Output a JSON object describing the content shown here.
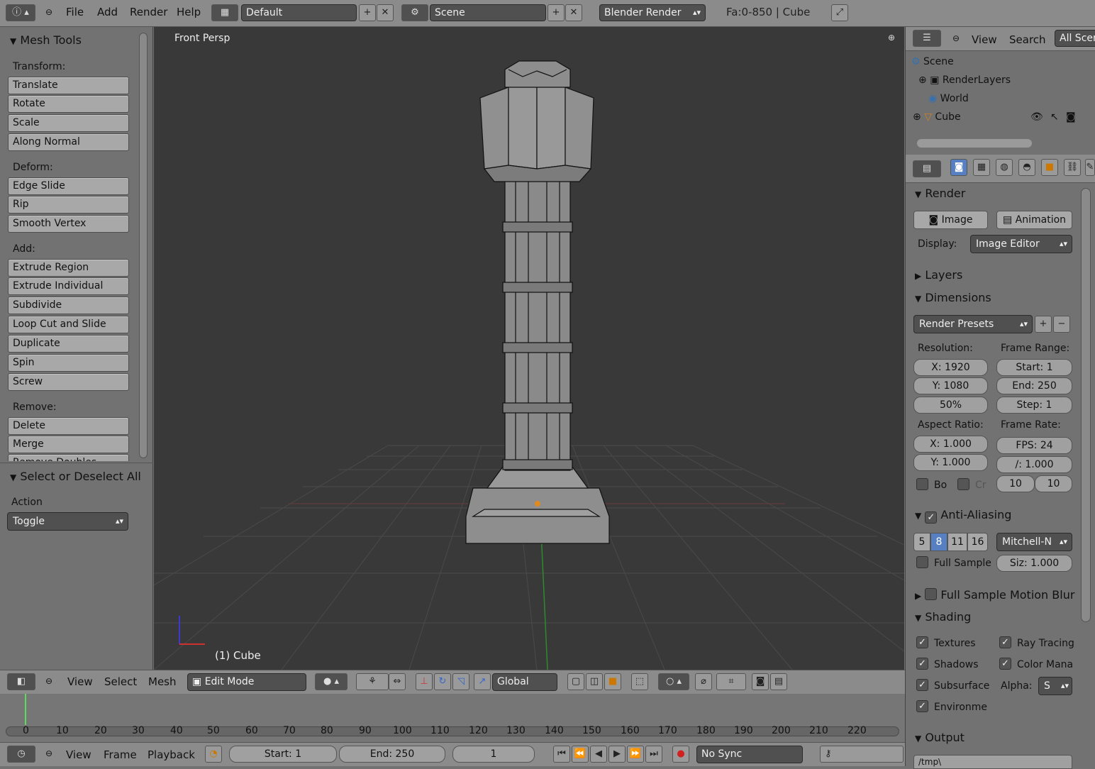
{
  "topbar": {
    "menus": [
      "File",
      "Add",
      "Render",
      "Help"
    ],
    "screen_layout": "Default",
    "scene": "Scene",
    "engine": "Blender Render",
    "stats": "Fa:0-850 | Cube"
  },
  "toolshelf": {
    "title": "Mesh Tools",
    "transform_label": "Transform:",
    "transform": [
      "Translate",
      "Rotate",
      "Scale",
      "Along Normal"
    ],
    "deform_label": "Deform:",
    "deform": [
      "Edge Slide",
      "Rip",
      "Smooth Vertex"
    ],
    "add_label": "Add:",
    "add": [
      "Extrude Region",
      "Extrude Individual",
      "Subdivide",
      "Loop Cut and Slide",
      "Duplicate",
      "Spin",
      "Screw"
    ],
    "remove_label": "Remove:",
    "remove": [
      "Delete",
      "Merge",
      "Remove Doubles"
    ],
    "operator_title": "Select or Deselect All",
    "action_label": "Action",
    "action_value": "Toggle"
  },
  "viewport": {
    "view_name": "Front Persp",
    "object_label": "(1) Cube"
  },
  "view_header": {
    "menus": [
      "View",
      "Select",
      "Mesh"
    ],
    "mode": "Edit Mode",
    "orientation": "Global"
  },
  "timeline": {
    "ticks": [
      "0",
      "10",
      "20",
      "30",
      "40",
      "50",
      "60",
      "70",
      "80",
      "90",
      "100",
      "110",
      "120",
      "130",
      "140",
      "150",
      "160",
      "170",
      "180",
      "190",
      "200",
      "210",
      "220"
    ],
    "menus": [
      "View",
      "Frame",
      "Playback"
    ],
    "start": "Start: 1",
    "end": "End: 250",
    "current": "1",
    "sync": "No Sync"
  },
  "outliner": {
    "menus": [
      "View",
      "Search"
    ],
    "filter": "All Scenes",
    "items": [
      "Scene",
      "RenderLayers",
      "World",
      "Cube"
    ]
  },
  "properties": {
    "render_title": "Render",
    "image_btn": "Image",
    "animation_btn": "Animation",
    "display_label": "Display:",
    "display_value": "Image Editor",
    "layers_title": "Layers",
    "dimensions_title": "Dimensions",
    "presets": "Render Presets",
    "resolution_label": "Resolution:",
    "res_x": "X: 1920",
    "res_y": "Y: 1080",
    "res_pct": "50%",
    "frame_range_label": "Frame Range:",
    "start": "Start: 1",
    "end": "End: 250",
    "step": "Step: 1",
    "aspect_label": "Aspect Ratio:",
    "asp_x": "X: 1.000",
    "asp_y": "Y: 1.000",
    "frame_rate_label": "Frame Rate:",
    "fps": "FPS: 24",
    "fps_base": "/: 1.000",
    "time_old": "10",
    "time_new": "10",
    "border": "Bo",
    "crop": "Cr",
    "aa_title": "Anti-Aliasing",
    "aa_samples": [
      "5",
      "8",
      "11",
      "16"
    ],
    "aa_filter": "Mitchell-N",
    "full_sample": "Full Sample",
    "aa_size": "Siz: 1.000",
    "motion_blur": "Full Sample Motion Blur",
    "shading_title": "Shading",
    "textures": "Textures",
    "ray_tracing": "Ray Tracing",
    "shadows": "Shadows",
    "color_mana": "Color Mana",
    "subsurface": "Subsurface",
    "alpha_label": "Alpha:",
    "alpha_value": "S",
    "environment": "Environme",
    "output_title": "Output",
    "output_path": "/tmp\\"
  },
  "colors": {
    "accent": "#5680c2",
    "viewport_bg": "#393939",
    "panel_bg": "#727272"
  }
}
